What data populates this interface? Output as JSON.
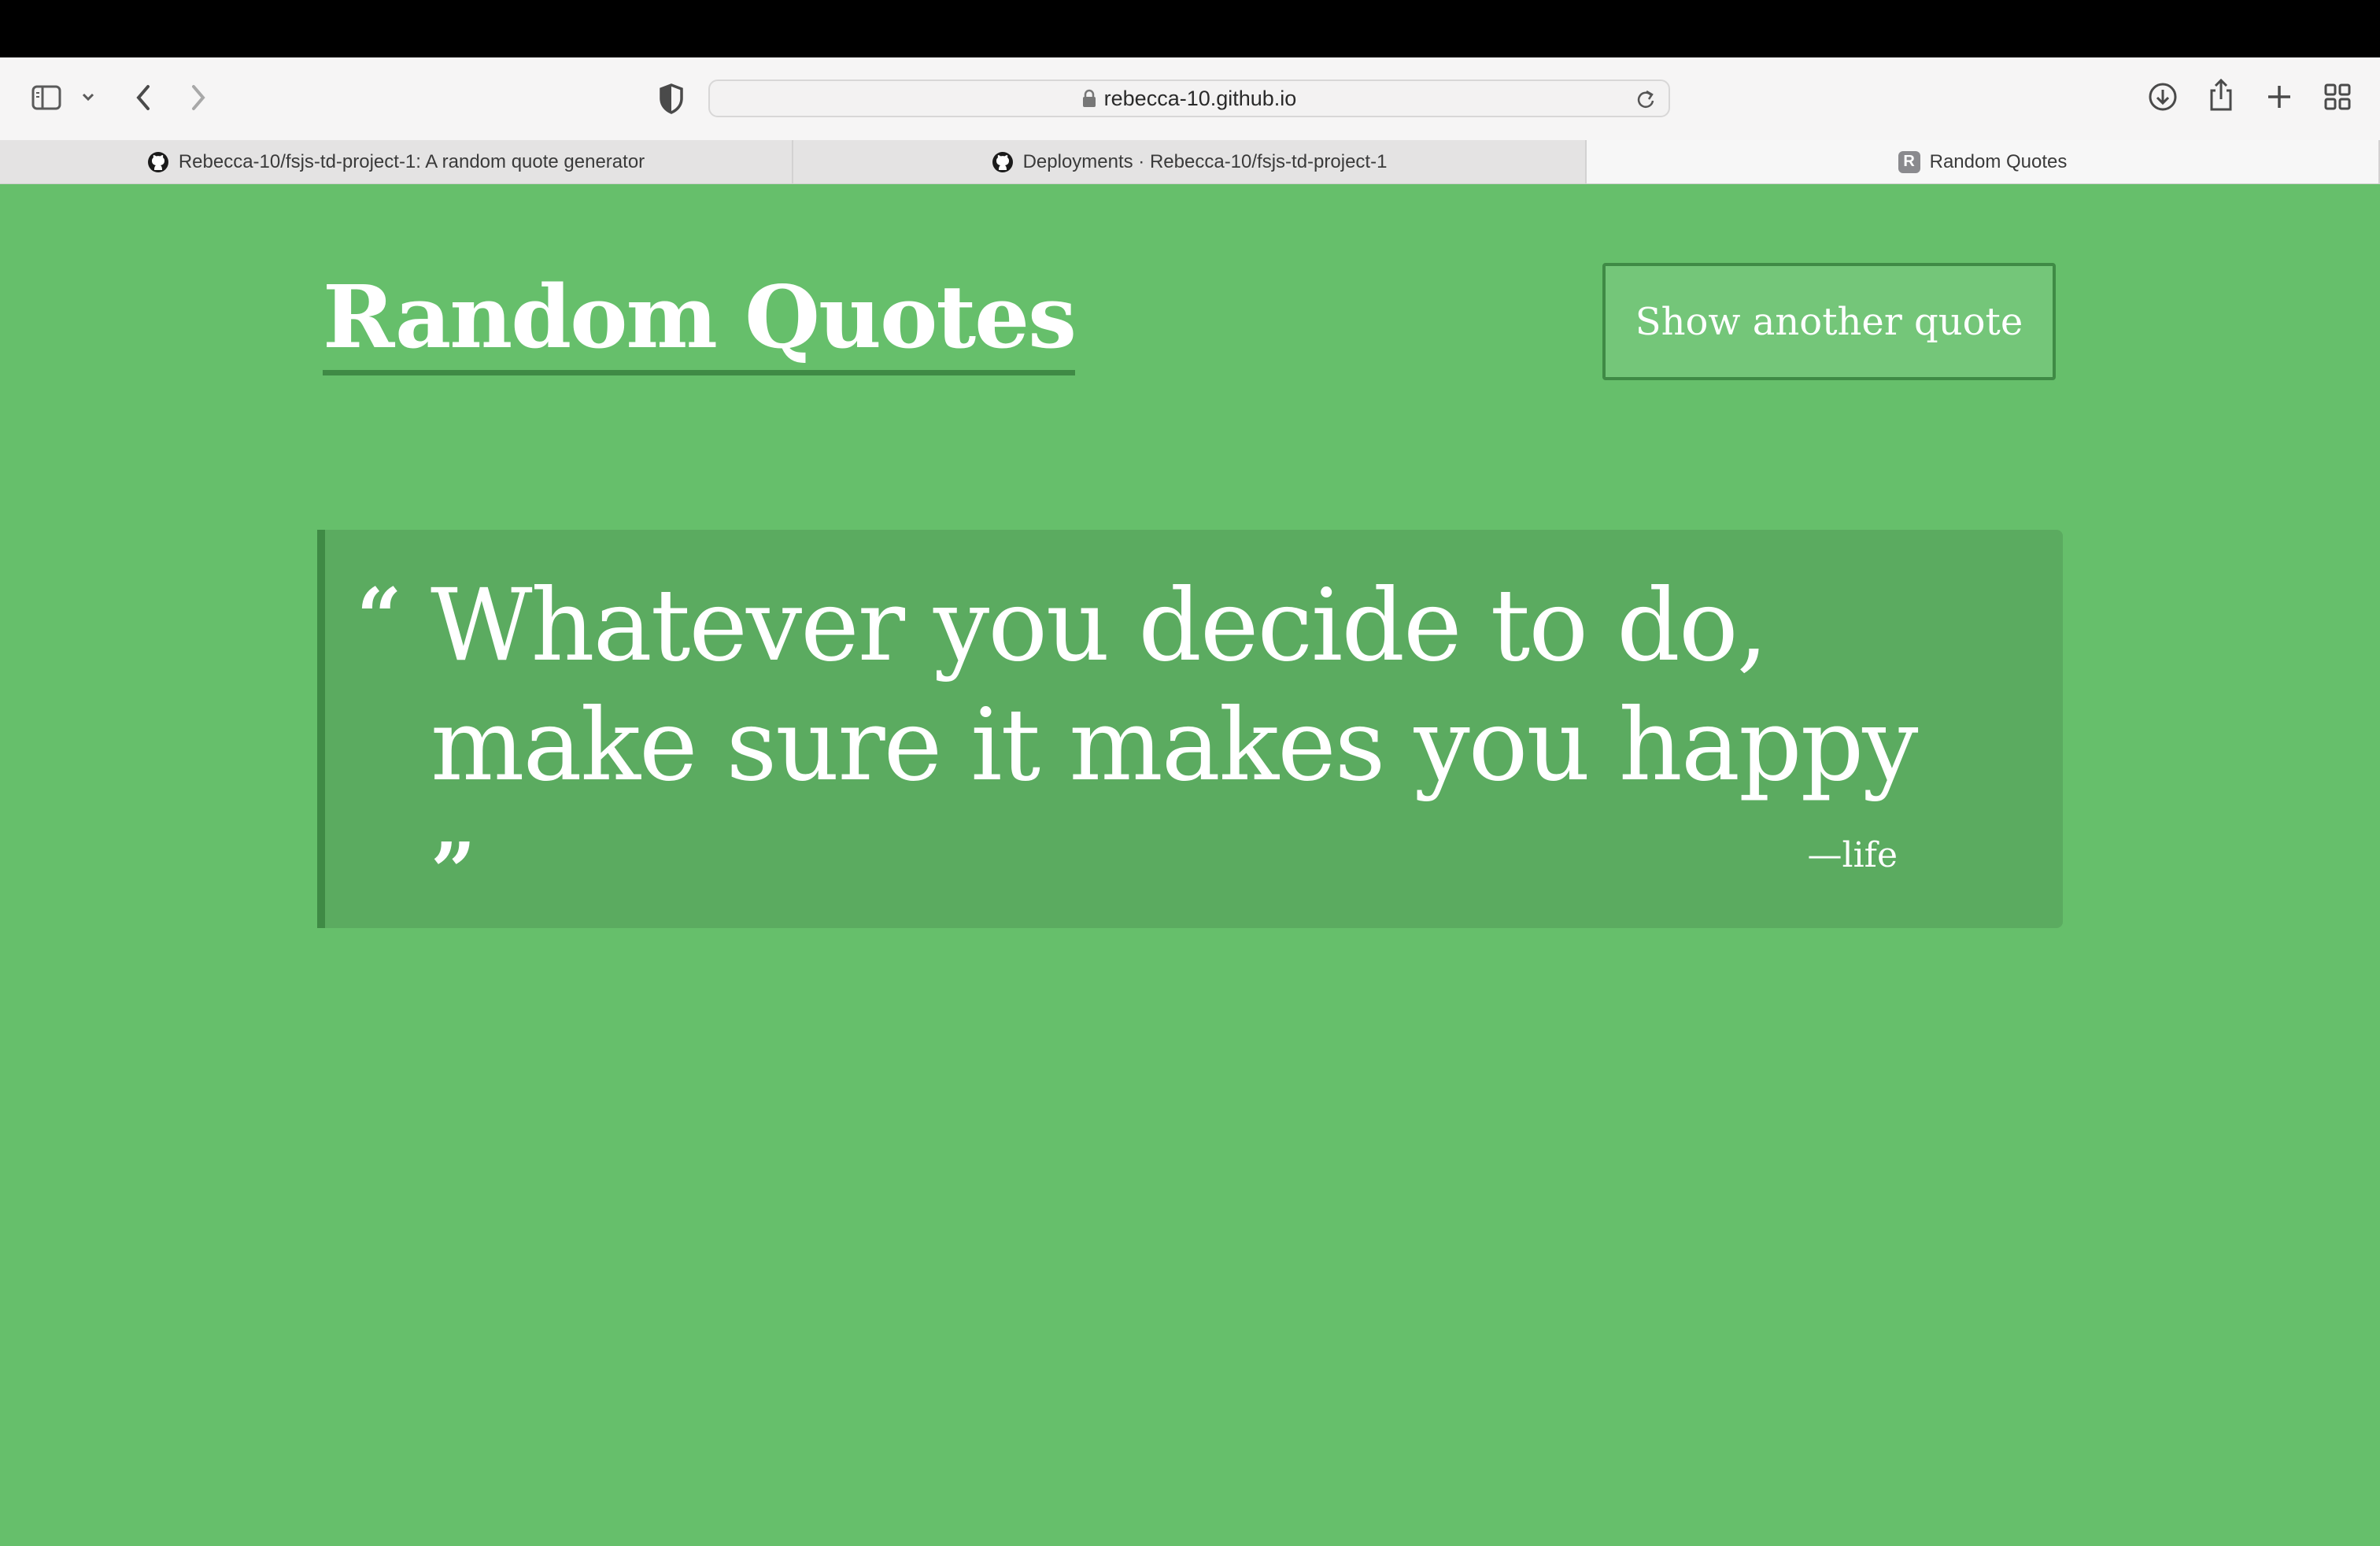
{
  "browser": {
    "url": "rebecca-10.github.io",
    "tabs": [
      {
        "label": "Rebecca-10/fsjs-td-project-1: A random quote generator",
        "icon": "github-icon",
        "active": false
      },
      {
        "label": "Deployments · Rebecca-10/fsjs-td-project-1",
        "icon": "github-icon",
        "active": false
      },
      {
        "label": "Random Quotes",
        "icon": "R",
        "active": true
      }
    ]
  },
  "page": {
    "title": "Random Quotes",
    "button_label": "Show another quote",
    "quote_open": "“",
    "quote": "Whatever you decide to do, make sure it makes you happy",
    "quote_close": "”",
    "source": "—life"
  },
  "colors": {
    "background": "#66bf6b",
    "quote_box": "#5bab60",
    "accent": "#3f8a45"
  }
}
